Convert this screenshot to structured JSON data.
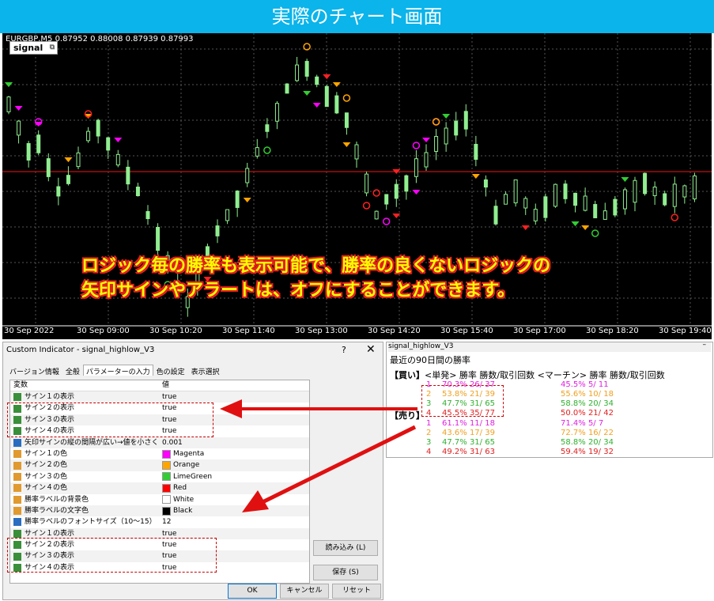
{
  "banner": {
    "title": "実際のチャート画面"
  },
  "chart": {
    "header": "EURGBP,M5  0.87952 0.88008 0.87939 0.87993",
    "signal_tag": "signal",
    "overlay_line1": "ロジック毎の勝率も表示可能で、勝率の良くないロジックの",
    "overlay_line2": "矢印サインやアラートは、オフにすることができます。",
    "x_labels": [
      "30 Sep 2022",
      "30 Sep 09:00",
      "30 Sep 10:20",
      "30 Sep 11:40",
      "30 Sep 13:00",
      "30 Sep 14:20",
      "30 Sep 15:40",
      "30 Sep 17:00",
      "30 Sep 18:20",
      "30 Sep 19:40"
    ]
  },
  "dialog": {
    "title": "Custom Indicator - signal_highlow_V3",
    "help": "?",
    "close": "✕",
    "tabs": [
      "バージョン情報",
      "全般",
      "パラメーターの入力",
      "色の設定",
      "表示選択"
    ],
    "columns": {
      "variable": "変数",
      "value": "値"
    },
    "rows": [
      {
        "name": "サイン１の表示",
        "value": "true",
        "icon": "bool"
      },
      {
        "name": "サイン２の表示",
        "value": "true",
        "icon": "bool"
      },
      {
        "name": "サイン３の表示",
        "value": "true",
        "icon": "bool"
      },
      {
        "name": "サイン４の表示",
        "value": "true",
        "icon": "bool"
      },
      {
        "name": "矢印サインの縦の間隔が広い→値を小さく",
        "value": "0.001",
        "icon": "num"
      },
      {
        "name": "サイン１の色",
        "value": "Magenta",
        "icon": "col",
        "swatch": "#ff00ff"
      },
      {
        "name": "サイン２の色",
        "value": "Orange",
        "icon": "col",
        "swatch": "#ffa500"
      },
      {
        "name": "サイン３の色",
        "value": "LimeGreen",
        "icon": "col",
        "swatch": "#32cd32"
      },
      {
        "name": "サイン４の色",
        "value": "Red",
        "icon": "col",
        "swatch": "#ff0000"
      },
      {
        "name": "勝率ラベルの背景色",
        "value": "White",
        "icon": "col",
        "swatch": "#ffffff"
      },
      {
        "name": "勝率ラベルの文字色",
        "value": "Black",
        "icon": "col",
        "swatch": "#000000"
      },
      {
        "name": "勝率ラベルのフォントサイズ（10〜15）",
        "value": "12",
        "icon": "num"
      },
      {
        "name": "サイン１の表示",
        "value": "true",
        "icon": "bool"
      },
      {
        "name": "サイン２の表示",
        "value": "true",
        "icon": "bool"
      },
      {
        "name": "サイン３の表示",
        "value": "true",
        "icon": "bool"
      },
      {
        "name": "サイン４の表示",
        "value": "true",
        "icon": "bool"
      }
    ],
    "buttons": {
      "load": "読み込み (L)",
      "save": "保存 (S)",
      "ok": "OK",
      "cancel": "キャンセル",
      "reset": "リセット"
    }
  },
  "popup": {
    "title": "signal_highlow_V3",
    "heading": "最近の90日間の勝率",
    "buy_label": "【買い】",
    "col_heads": "<単発> 勝率 勝数/取引回数   <マーチン> 勝率 勝数/取引回数",
    "sell_label": "【売り】",
    "buy": [
      {
        "n": "1",
        "single": "70.3%  26/ 37",
        "martin": "45.5%   5/ 11",
        "color": "#e020e0"
      },
      {
        "n": "2",
        "single": "53.8%  21/ 39",
        "martin": "55.6%  10/ 18",
        "color": "#f0a020"
      },
      {
        "n": "3",
        "single": "47.7%  31/ 65",
        "martin": "58.8%  20/ 34",
        "color": "#30b030"
      },
      {
        "n": "4",
        "single": "45.5%  35/ 77",
        "martin": "50.0%  21/ 42",
        "color": "#e02020"
      }
    ],
    "sell": [
      {
        "n": "1",
        "single": "61.1%  11/ 18",
        "martin": "71.4%   5/  7",
        "color": "#e020e0"
      },
      {
        "n": "2",
        "single": "43.6%  17/ 39",
        "martin": "72.7%  16/ 22",
        "color": "#f0a020"
      },
      {
        "n": "3",
        "single": "47.7%  31/ 65",
        "martin": "58.8%  20/ 34",
        "color": "#30b030"
      },
      {
        "n": "4",
        "single": "49.2%  31/ 63",
        "martin": "59.4%  19/ 32",
        "color": "#e02020"
      }
    ]
  }
}
